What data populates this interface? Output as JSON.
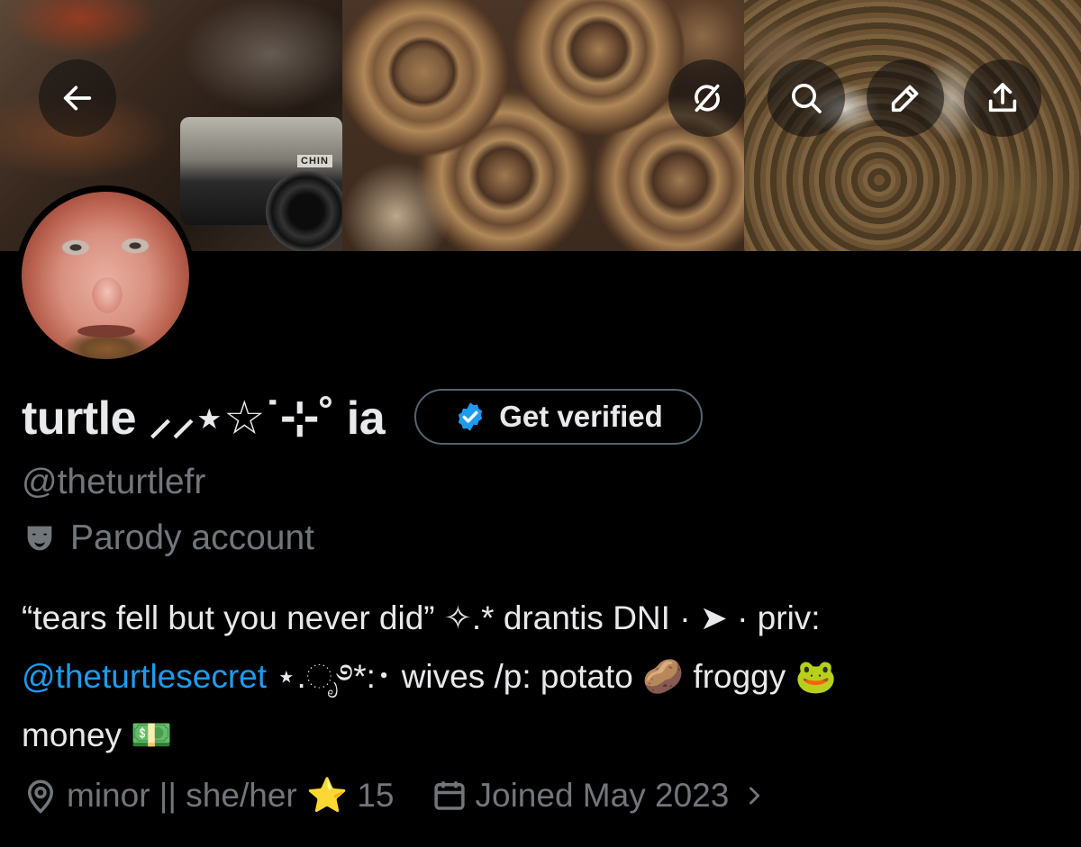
{
  "header": {
    "back_icon": "arrow-left-icon",
    "grok_icon": "grok-icon",
    "search_icon": "search-icon",
    "edit_icon": "pencil-icon",
    "share_icon": "share-icon",
    "banner_camera_text": "CHIN"
  },
  "profile": {
    "display_name": "turtle ⸝⸝⋆☆˙⊹˚ ia",
    "get_verified_label": "Get verified",
    "handle": "@theturtlefr",
    "parody_label": "Parody account",
    "bio_line1": "“tears fell but you never did” ✧.* drantis DNI  · ➤ ·  priv:",
    "bio_mention": "@theturtlesecret",
    "bio_line2_rest": " ⋆.ೃ࿔*:･ wives /p: potato 🥔 froggy 🐸",
    "bio_line3": "money 💵",
    "location": "minor || she/her ⭐ 15",
    "joined": "Joined May 2023"
  },
  "colors": {
    "background": "#000000",
    "text_primary": "#e7e9ea",
    "text_secondary": "#71767b",
    "link": "#1d9bf0",
    "verified_badge": "#1d9bf0",
    "button_border": "#536471"
  }
}
